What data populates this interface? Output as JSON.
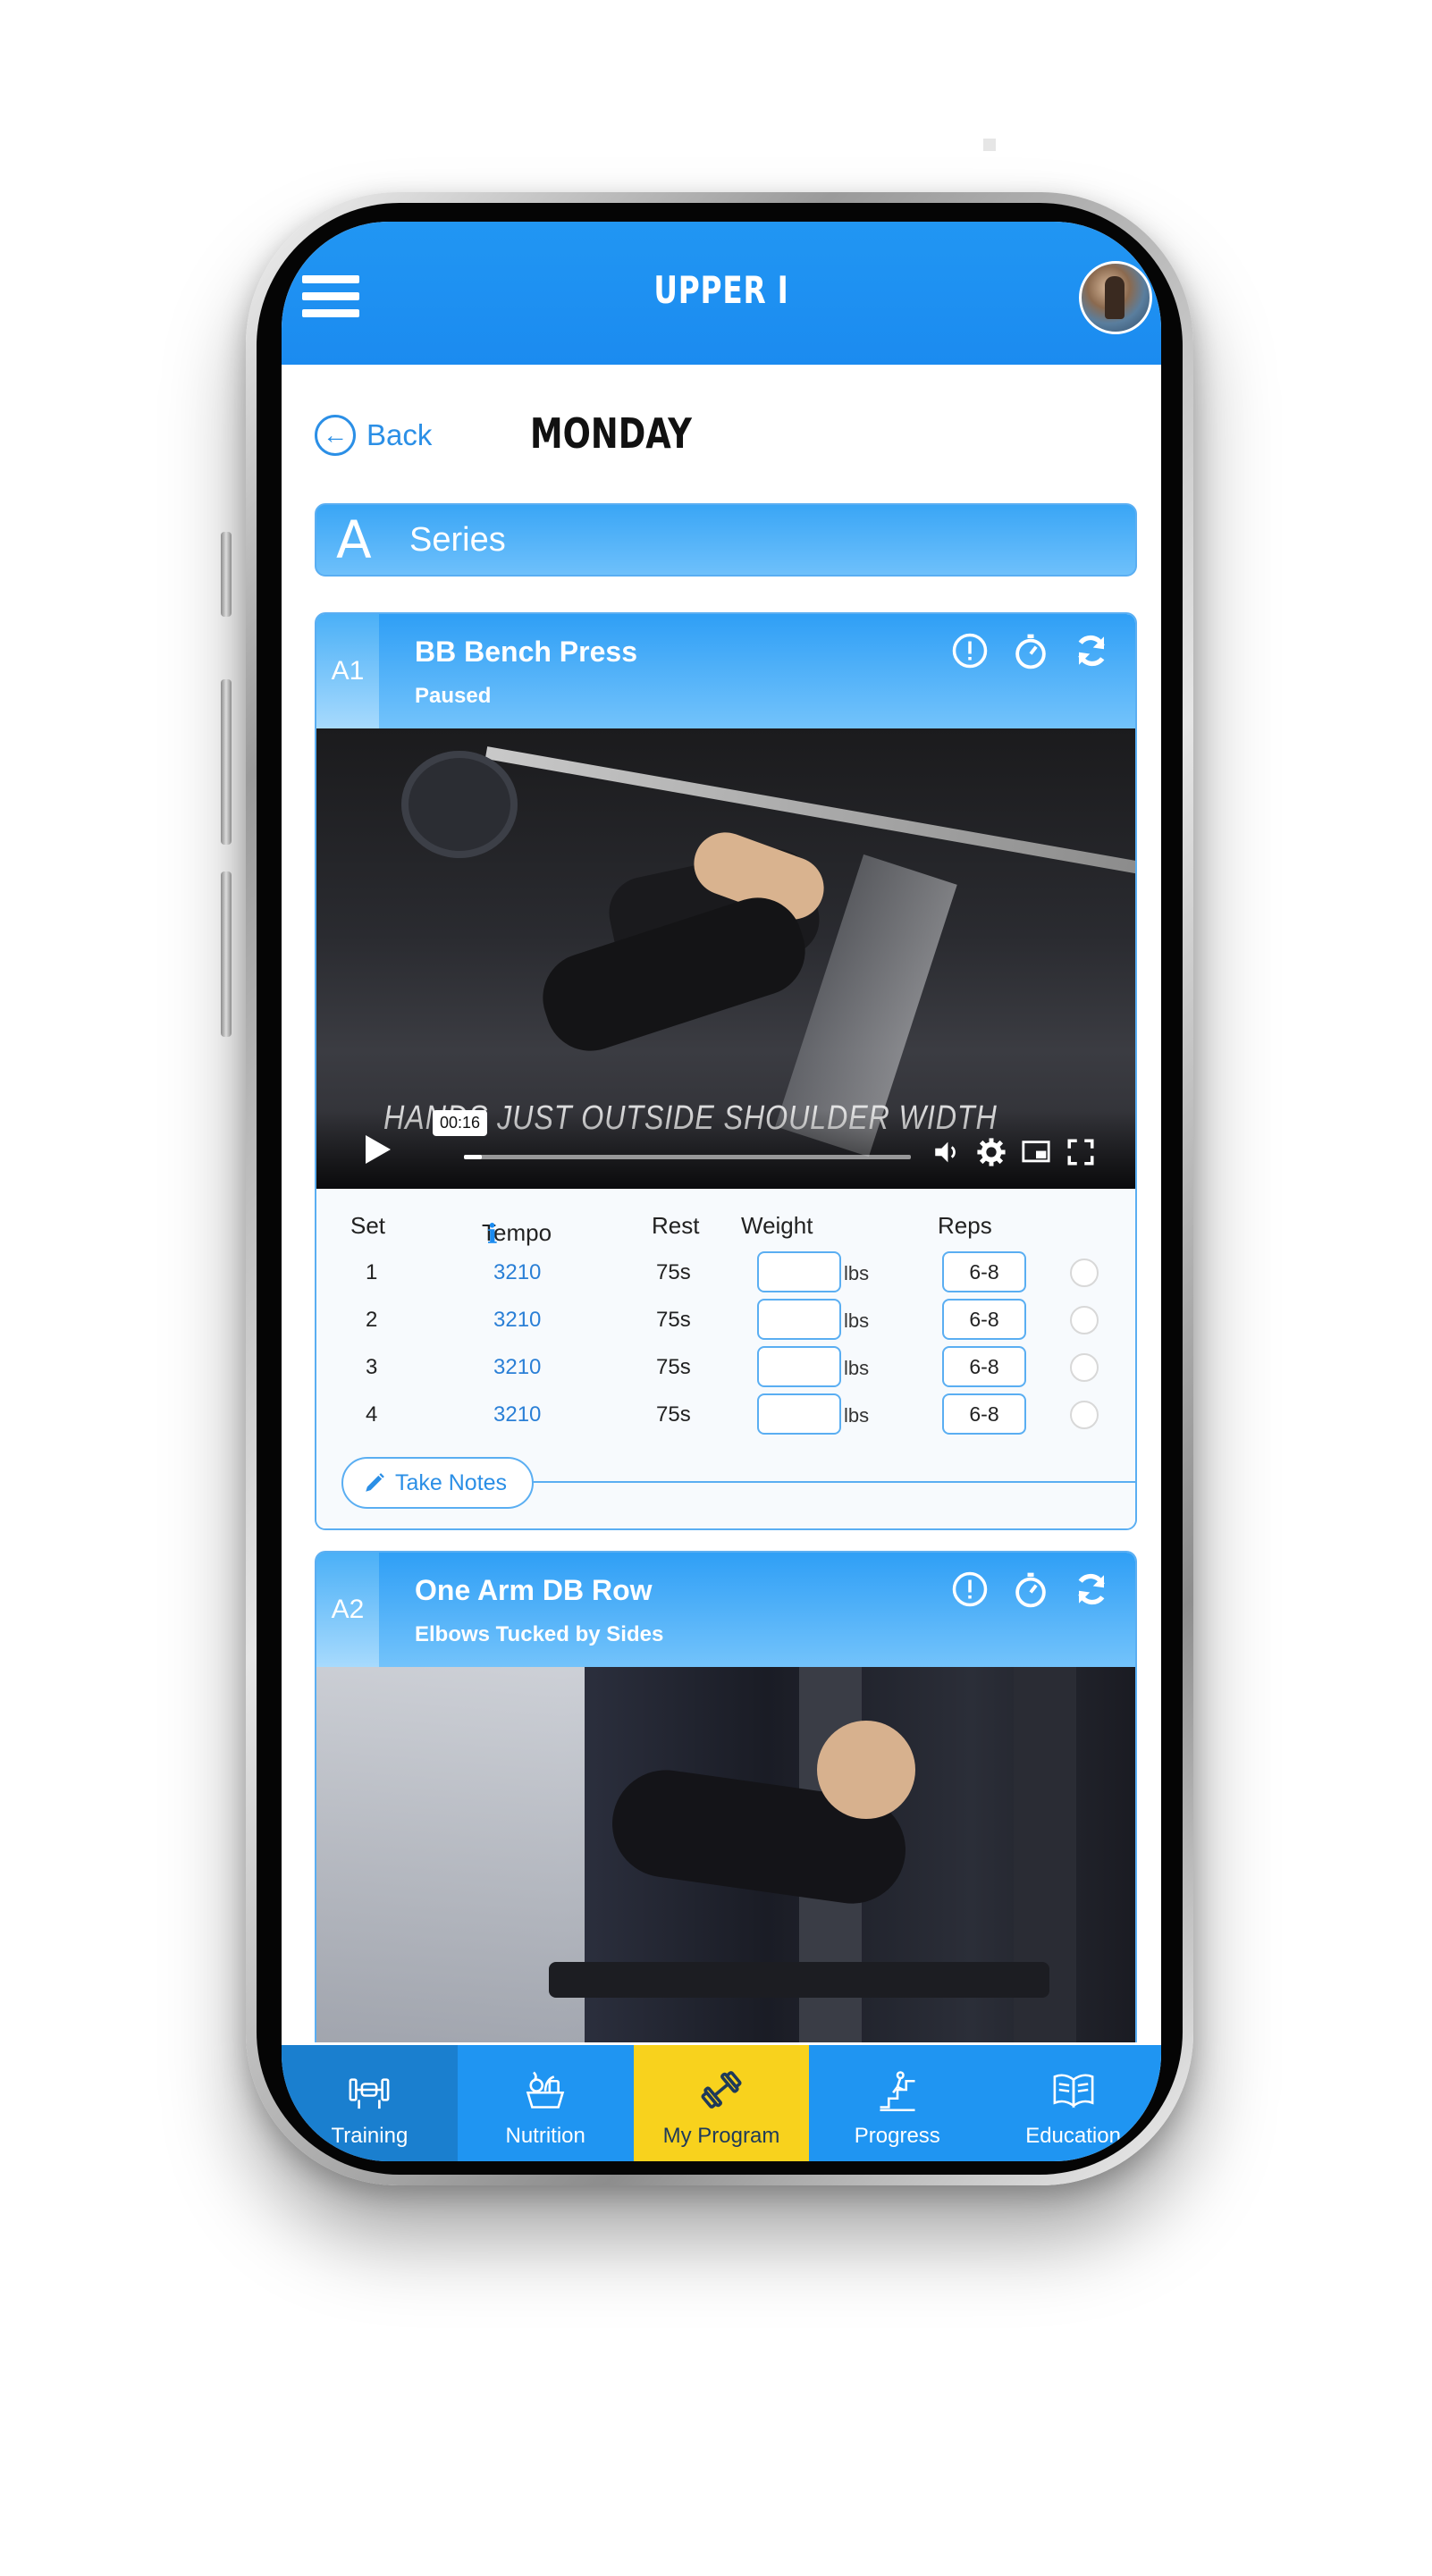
{
  "header": {
    "title": "UPPER I"
  },
  "page": {
    "back_label": "Back",
    "day": "MONDAY"
  },
  "series": {
    "letter": "A",
    "label": "Series"
  },
  "table_headers": {
    "set": "Set",
    "tempo": "Tempo",
    "rest": "Rest",
    "weight": "Weight",
    "reps": "Reps"
  },
  "units": {
    "weight": "lbs"
  },
  "exercises": [
    {
      "code": "A1",
      "name": "BB Bench Press",
      "note": "Paused",
      "video": {
        "caption": "HANDS JUST OUTSIDE SHOULDER WIDTH",
        "time": "00:16",
        "progress": 0.04
      },
      "sets": [
        {
          "set": "1",
          "tempo": "3210",
          "rest": "75s",
          "weight": "",
          "reps": "6-8"
        },
        {
          "set": "2",
          "tempo": "3210",
          "rest": "75s",
          "weight": "",
          "reps": "6-8"
        },
        {
          "set": "3",
          "tempo": "3210",
          "rest": "75s",
          "weight": "",
          "reps": "6-8"
        },
        {
          "set": "4",
          "tempo": "3210",
          "rest": "75s",
          "weight": "",
          "reps": "6-8"
        }
      ],
      "notes_label": "Take Notes"
    },
    {
      "code": "A2",
      "name": "One Arm DB Row",
      "note": "Elbows Tucked by Sides"
    }
  ],
  "bottom_nav": [
    {
      "label": "Training",
      "icon": "dumbbell-rack-icon"
    },
    {
      "label": "Nutrition",
      "icon": "food-basket-icon"
    },
    {
      "label": "My Program",
      "icon": "dumbbell-icon",
      "active": true
    },
    {
      "label": "Progress",
      "icon": "progress-stairs-icon"
    },
    {
      "label": "Education",
      "icon": "book-icon"
    }
  ],
  "colors": {
    "primary": "#1f95f2",
    "accent": "#f8d21d",
    "link": "#2b8fe6"
  }
}
